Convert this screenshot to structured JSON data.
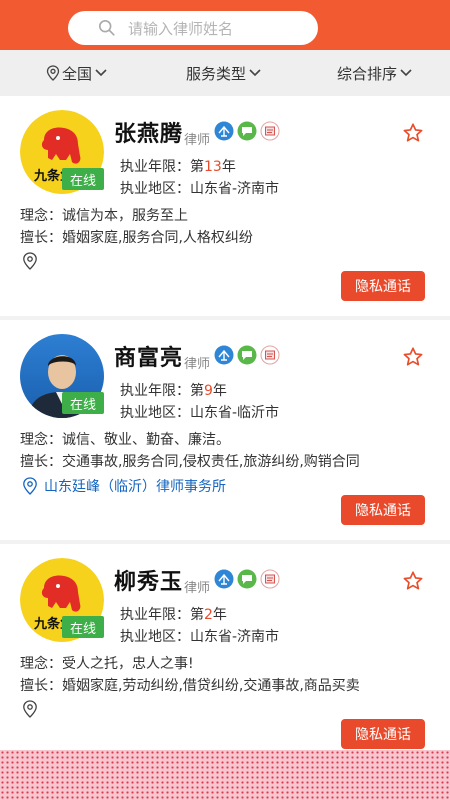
{
  "search": {
    "placeholder": "请输入律师姓名"
  },
  "filters": [
    {
      "label": "全国"
    },
    {
      "label": "服务类型"
    },
    {
      "label": "综合排序"
    }
  ],
  "colors": {
    "accent": "#f25a31",
    "online": "#3dae48",
    "link": "#1565c0"
  },
  "lawyers": [
    {
      "name": "张燕腾",
      "role": "律师",
      "status": "在线",
      "years_prefix": "执业年限：第",
      "years": "13",
      "years_suffix": "年",
      "region": "执业地区：山东省-济南市",
      "motto": "理念：诚信为本，服务至上",
      "skills": "擅长：婚姻家庭,服务合同,人格权纠纷",
      "firm": "",
      "call_label": "隐私通话",
      "avatar": "jiufa-elephant-logo"
    },
    {
      "name": "商富亮",
      "role": "律师",
      "status": "在线",
      "years_prefix": "执业年限：第",
      "years": "9",
      "years_suffix": "年",
      "region": "执业地区：山东省-临沂市",
      "motto": "理念：诚信、敬业、勤奋、廉洁。",
      "skills": "擅长：交通事故,服务合同,侵权责任,旅游纠纷,购销合同",
      "firm": "山东廷峰（临沂）律师事务所",
      "call_label": "隐私通话",
      "avatar": "person-photo"
    },
    {
      "name": "柳秀玉",
      "role": "律师",
      "status": "在线",
      "years_prefix": "执业年限：第",
      "years": "2",
      "years_suffix": "年",
      "region": "执业地区：山东省-济南市",
      "motto": "理念：受人之托，忠人之事!",
      "skills": "擅长：婚姻家庭,劳动纠纷,借贷纠纷,交通事故,商品买卖",
      "firm": "",
      "call_label": "隐私通话",
      "avatar": "jiufa-elephant-logo"
    }
  ],
  "logo_text": "九条鱼"
}
